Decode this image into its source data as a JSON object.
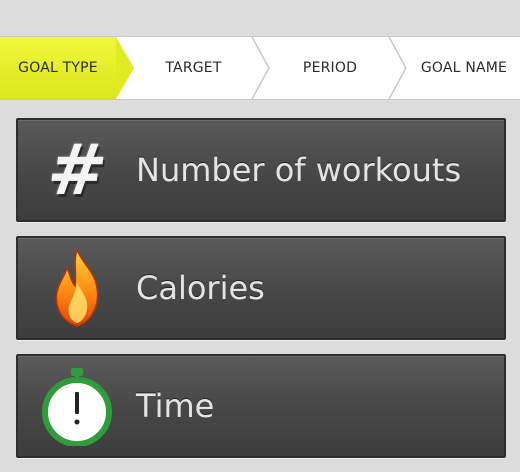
{
  "steps": [
    {
      "label": "GOAL TYPE",
      "active": true
    },
    {
      "label": "TARGET",
      "active": false
    },
    {
      "label": "PERIOD",
      "active": false
    },
    {
      "label": "GOAL NAME",
      "active": false
    }
  ],
  "options": [
    {
      "label": "Number of workouts",
      "icon": "hash-icon"
    },
    {
      "label": "Calories",
      "icon": "flame-icon"
    },
    {
      "label": "Time",
      "icon": "stopwatch-icon"
    }
  ],
  "colors": {
    "active_step": "#e4ee2a",
    "panel": "#4a4a4a",
    "text_light": "#e4e4e4"
  }
}
